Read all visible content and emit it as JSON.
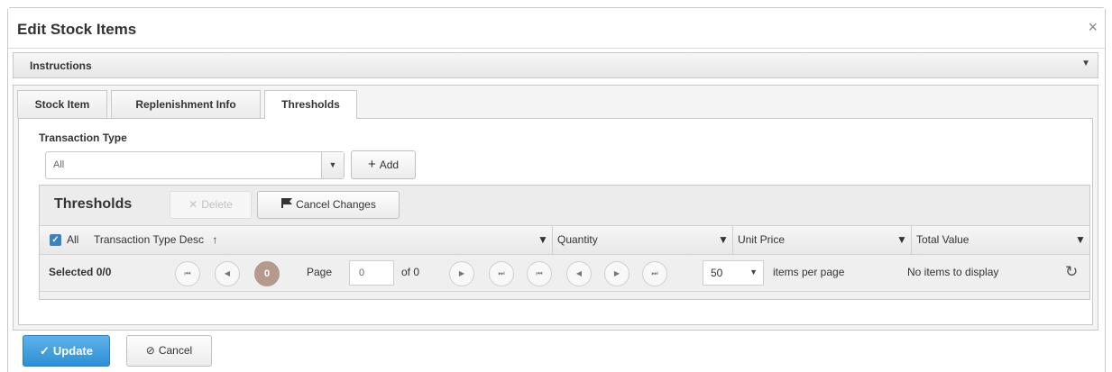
{
  "dialog": {
    "title": "Edit Stock Items",
    "close_glyph": "×"
  },
  "instructions": {
    "label": "Instructions",
    "arrow": "▼"
  },
  "tabs": [
    {
      "label": "Stock Item",
      "active": false
    },
    {
      "label": "Replenishment Info",
      "active": false
    },
    {
      "label": "Thresholds",
      "active": true
    }
  ],
  "form": {
    "transaction_type_label": "Transaction Type",
    "transaction_type_value": "All",
    "dropdown_arrow": "▼",
    "add_icon": "+",
    "add_label": "Add"
  },
  "grid": {
    "title": "Thresholds",
    "delete_icon": "✕",
    "delete_label": "Delete",
    "cancel_changes_label": "Cancel Changes",
    "select_all_label": "All",
    "check_glyph": "✓",
    "sort_icon": "↑",
    "filter_glyph": "▼",
    "columns": [
      "Transaction Type Desc",
      "Quantity",
      "Unit Price",
      "Total Value"
    ]
  },
  "pager": {
    "selected": "Selected 0/0",
    "first": "⏮",
    "prev": "◀",
    "current_page": "0",
    "page_label": "Page",
    "page_input": "0",
    "of_label": "of 0",
    "next": "▶",
    "last": "⏭",
    "page_size": "50",
    "items_per_page": "items per page",
    "no_items": "No items to display",
    "refresh_glyph": "↻"
  },
  "footer": {
    "update_icon": "✓",
    "update_label": "Update",
    "cancel_icon": "⊘",
    "cancel_label": "Cancel"
  }
}
